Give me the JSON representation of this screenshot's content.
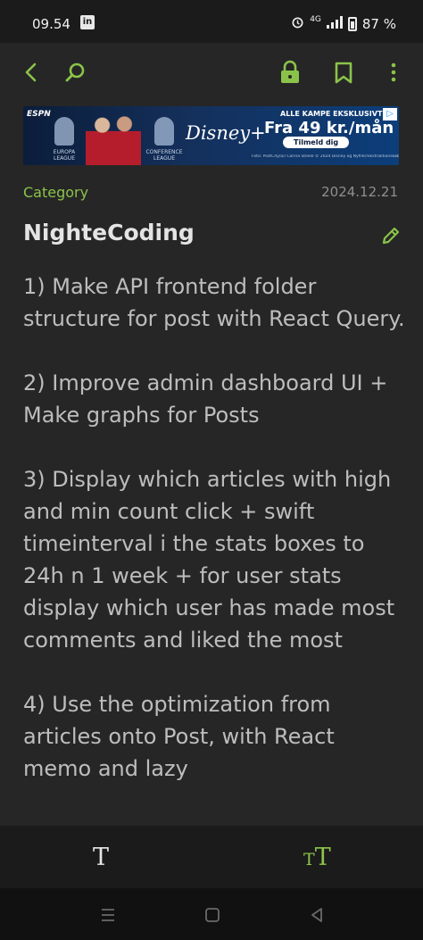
{
  "status_bar": {
    "time": "09.54",
    "notification_icon": "linkedin-icon",
    "signal_label": "4G",
    "battery": "87 %"
  },
  "top_bar": {
    "back_icon": "chevron-left-icon",
    "search_icon": "search-icon",
    "lock_icon": "lock-icon",
    "bookmark_icon": "bookmark-icon",
    "more_icon": "more-vertical-icon",
    "accent_color": "#8bc34a"
  },
  "ad": {
    "espn": "ESPN",
    "league_left": "EUROPA LEAGUE",
    "league_right": "CONFERENCE LEAGUE",
    "brand": "Disney+",
    "headline": "ALLE KAMPE EKSKLUSIVT",
    "price": "Fra 49 kr./mån",
    "cta": "Tilmeld dig",
    "fine_print": "Foto: PostCity/a/i Carina Steele © 2024 Disney og Nyfiler/ekstraktionskøber Abonnement påkrævet. 1,0. Vilkår gælder.Læs mere på Disneyplus.com",
    "ad_choice_icon": "ad-choices-icon"
  },
  "note": {
    "category": "Category",
    "date": "2024.12.21",
    "title": "NighteCoding",
    "edit_icon": "pencil-icon",
    "paragraphs": [
      "1) Make API frontend folder structure for post with React Query.",
      "2) Improve admin dashboard UI + Make graphs for Posts",
      "3) Display which articles with high and min count click + swift timeinterval i the stats boxes to 24h n 1 week + for user stats display which user has made most comments and liked the most",
      "4) Use the optimization from articles onto Post, with React memo and lazy"
    ]
  },
  "bottom_toolbar": {
    "text_style_label": "T",
    "text_size_small": "T",
    "text_size_big": "T"
  },
  "nav_bar": {
    "recents_icon": "recents-icon",
    "home_icon": "home-icon",
    "back_icon": "back-triangle-icon"
  }
}
